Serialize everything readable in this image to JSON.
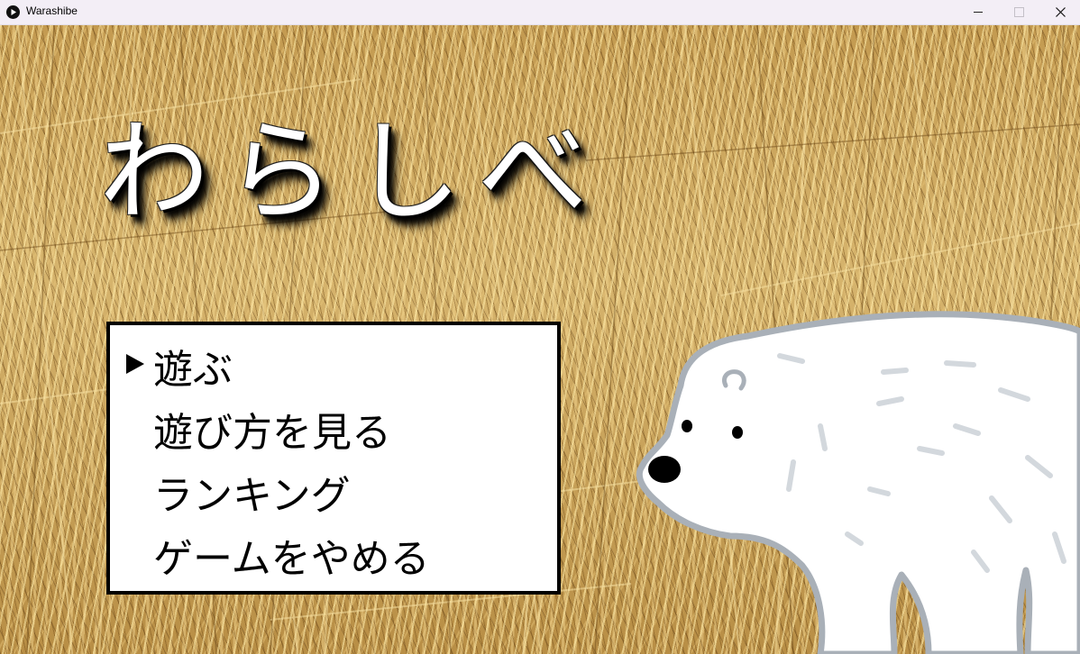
{
  "window": {
    "title": "Warashibe",
    "app_icon": "play-circle-icon",
    "controls": [
      "minimize-icon",
      "maximize-icon",
      "close-icon"
    ]
  },
  "game": {
    "title": "わらしべ",
    "menu": {
      "selected_index": 0,
      "cursor_glyph": "▶",
      "items": [
        {
          "label": "遊ぶ"
        },
        {
          "label": "遊び方を見る"
        },
        {
          "label": "ランキング"
        },
        {
          "label": "ゲームをやめる"
        }
      ]
    },
    "mascot": "polar-bear",
    "background": "straw-texture",
    "colors": {
      "menu_bg": "#ffffff",
      "menu_border": "#000000",
      "title_fill": "#ffffff",
      "title_shadow": "#000000",
      "bear_outline": "#a9b0b8"
    }
  }
}
